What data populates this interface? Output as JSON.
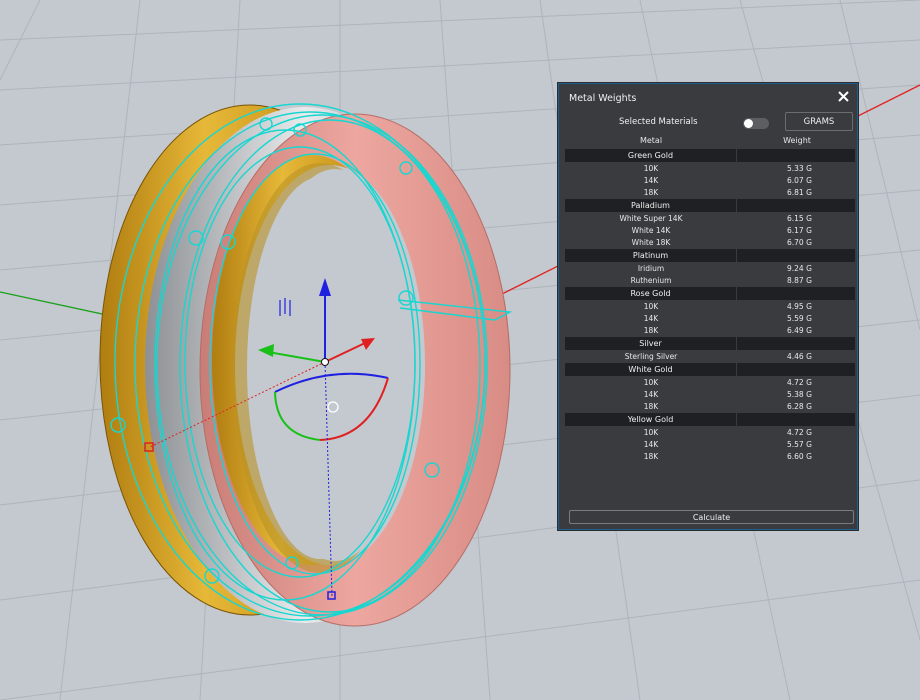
{
  "panel": {
    "title": "Metal Weights",
    "selected_materials_label": "Selected Materials",
    "selected_materials_on": false,
    "units_button": "GRAMS",
    "columns": {
      "metal": "Metal",
      "weight": "Weight"
    },
    "groups": [
      {
        "name": "Green Gold",
        "items": [
          {
            "name": "10K",
            "weight": "5.33 G"
          },
          {
            "name": "14K",
            "weight": "6.07 G"
          },
          {
            "name": "18K",
            "weight": "6.81 G"
          }
        ]
      },
      {
        "name": "Palladium",
        "items": [
          {
            "name": "White Super 14K",
            "weight": "6.15 G"
          },
          {
            "name": "White 14K",
            "weight": "6.17 G"
          },
          {
            "name": "White 18K",
            "weight": "6.70 G"
          }
        ]
      },
      {
        "name": "Platinum",
        "items": [
          {
            "name": "Iridium",
            "weight": "9.24 G"
          },
          {
            "name": "Ruthenium",
            "weight": "8.87 G"
          }
        ]
      },
      {
        "name": "Rose Gold",
        "items": [
          {
            "name": "10K",
            "weight": "4.95 G"
          },
          {
            "name": "14K",
            "weight": "5.59 G"
          },
          {
            "name": "18K",
            "weight": "6.49 G"
          }
        ]
      },
      {
        "name": "Silver",
        "items": [
          {
            "name": "Sterling Silver",
            "weight": "4.46 G"
          }
        ]
      },
      {
        "name": "White Gold",
        "items": [
          {
            "name": "10K",
            "weight": "4.72 G"
          },
          {
            "name": "14K",
            "weight": "5.38 G"
          },
          {
            "name": "18K",
            "weight": "6.28 G"
          }
        ]
      },
      {
        "name": "Yellow Gold",
        "items": [
          {
            "name": "10K",
            "weight": "4.72 G"
          },
          {
            "name": "14K",
            "weight": "5.57 G"
          },
          {
            "name": "18K",
            "weight": "6.60 G"
          }
        ]
      }
    ],
    "calculate_button": "Calculate"
  },
  "colors": {
    "viewport_bg": "#c4c9cf",
    "grid_line": "#aeb4bb",
    "x_axis": "#e02020",
    "y_axis": "#20a020",
    "gold": "#d6a21e",
    "rose": "#e39a94",
    "curves": "#18d6d0",
    "panel_bg": "#3a3b3f",
    "panel_border": "#1d5f8c"
  },
  "viewport": {
    "objects": [
      "ring",
      "gumball-manipulator",
      "selection-curves"
    ]
  }
}
